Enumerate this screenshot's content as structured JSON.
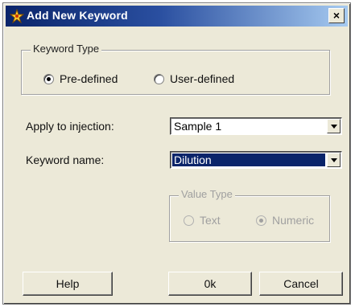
{
  "window": {
    "title": "Add New Keyword",
    "close_label": "×"
  },
  "keyword_type": {
    "legend": "Keyword Type",
    "options": [
      {
        "label": "Pre-defined",
        "selected": true
      },
      {
        "label": "User-defined",
        "selected": false
      }
    ]
  },
  "apply_to": {
    "label": "Apply to injection:",
    "value": "Sample 1"
  },
  "keyword_name": {
    "label": "Keyword name:",
    "value": "Dilution"
  },
  "value_type": {
    "legend": "Value Type",
    "options": [
      {
        "label": "Text",
        "selected": false
      },
      {
        "label": "Numeric",
        "selected": true
      }
    ]
  },
  "buttons": {
    "help": "Help",
    "ok": "0k",
    "cancel": "Cancel"
  },
  "colors": {
    "title_bar_start": "#0a246a",
    "title_bar_end": "#a6caf0",
    "dialog_face": "#ece9d8",
    "selection": "#0a246a"
  }
}
